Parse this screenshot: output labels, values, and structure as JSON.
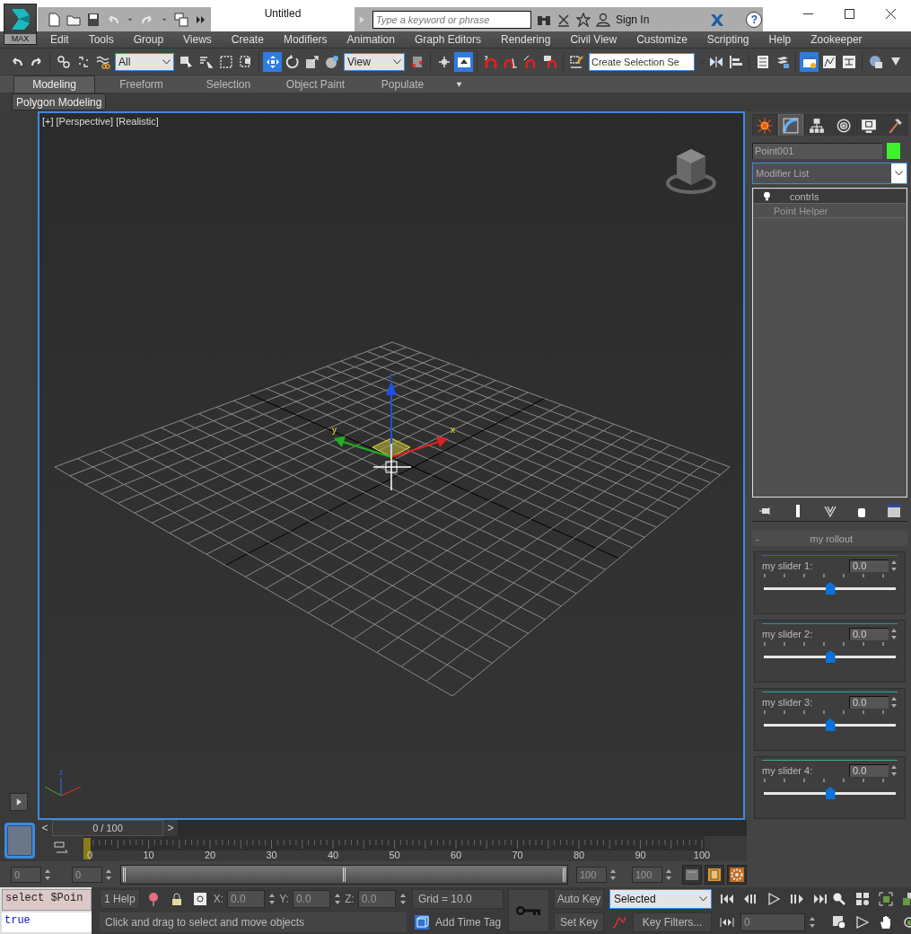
{
  "title_bar": {
    "app_label": "MAX",
    "title": "Untitled",
    "search_placeholder": "Type a keyword or phrase",
    "sign_in": "Sign In",
    "help": "?"
  },
  "menu": [
    "Edit",
    "Tools",
    "Group",
    "Views",
    "Create",
    "Modifiers",
    "Animation",
    "Graph Editors",
    "Rendering",
    "Civil View",
    "Customize",
    "Scripting",
    "Help",
    "Zookeeper"
  ],
  "main_toolbar": [
    {
      "kind": "undo",
      "selected": false
    },
    {
      "kind": "redo",
      "selected": false
    },
    {
      "kind": "sep"
    },
    {
      "kind": "link",
      "selected": false
    },
    {
      "kind": "unlink",
      "selected": false
    },
    {
      "kind": "wave",
      "selected": false
    },
    {
      "kind": "dropdown",
      "value": "All"
    },
    {
      "kind": "cursor",
      "selected": false
    },
    {
      "kind": "list-cursor",
      "selected": false
    },
    {
      "kind": "dashed-square",
      "selected": false
    },
    {
      "kind": "crossing",
      "selected": false
    },
    {
      "kind": "sep"
    },
    {
      "kind": "move",
      "selected": true
    },
    {
      "kind": "rotate",
      "selected": false
    },
    {
      "kind": "scale",
      "selected": false
    },
    {
      "kind": "sphere",
      "selected": false
    },
    {
      "kind": "dropdown",
      "value": "View"
    },
    {
      "kind": "pivot",
      "selected": false
    },
    {
      "kind": "sep"
    },
    {
      "kind": "crosshair",
      "selected": false
    },
    {
      "kind": "up-arrow-square",
      "selected": true
    },
    {
      "kind": "sep"
    },
    {
      "kind": "magnet",
      "selected": false
    },
    {
      "kind": "angle-magnet",
      "selected": false
    },
    {
      "kind": "percent-magnet",
      "selected": false
    },
    {
      "kind": "spinner-magnet",
      "selected": false
    },
    {
      "kind": "sep"
    },
    {
      "kind": "pencil",
      "selected": false
    },
    {
      "kind": "combo",
      "placeholder": "Create Selection Se"
    },
    {
      "kind": "mirror",
      "selected": false
    },
    {
      "kind": "align",
      "selected": false
    },
    {
      "kind": "sep"
    },
    {
      "kind": "list-window",
      "selected": false
    },
    {
      "kind": "layers",
      "selected": false
    },
    {
      "kind": "sep"
    },
    {
      "kind": "window-bulb",
      "selected": true
    },
    {
      "kind": "graph-window",
      "selected": false
    },
    {
      "kind": "schematic",
      "selected": false
    },
    {
      "kind": "sep"
    },
    {
      "kind": "globe",
      "selected": false
    },
    {
      "kind": "more",
      "selected": false
    }
  ],
  "ribbon": {
    "tabs": [
      {
        "label": "Modeling",
        "selected": true
      },
      {
        "label": "Freeform",
        "selected": false
      },
      {
        "label": "Selection",
        "selected": false
      },
      {
        "label": "Object Paint",
        "selected": false
      },
      {
        "label": "Populate",
        "selected": false
      }
    ],
    "panel": "Polygon Modeling"
  },
  "viewport": {
    "labels": [
      "[+]",
      "[Perspective]",
      "[Realistic]"
    ],
    "gizmo_axes": [
      "z",
      "y",
      "x"
    ],
    "tripod_axes": [
      "z"
    ]
  },
  "command_panel": {
    "tabs": [
      {
        "kind": "create",
        "selected": false
      },
      {
        "kind": "modify",
        "selected": true
      },
      {
        "kind": "hierarchy",
        "selected": false
      },
      {
        "kind": "motion",
        "selected": false
      },
      {
        "kind": "display",
        "selected": false
      },
      {
        "kind": "utilities",
        "selected": false
      }
    ],
    "object": {
      "name": "Point001",
      "color": "#3cf22c"
    },
    "modifier_list": "Modifier List",
    "stack": [
      {
        "label": "contrls",
        "selected": true
      },
      {
        "label": "Point Helper",
        "selected": false
      }
    ],
    "rollout": {
      "toggle": "-",
      "title": "my rollout",
      "sliders": [
        {
          "label": "my slider 1:",
          "value": "0.0",
          "level": 0.5,
          "color": "#4a55b0"
        },
        {
          "label": "my slider 2:",
          "value": "0.0",
          "level": 0.5,
          "color": "#3a8cb8"
        },
        {
          "label": "my slider 3:",
          "value": "0.0",
          "level": 0.5,
          "color": "#2aa894"
        },
        {
          "label": "my slider 4:",
          "value": "0.0",
          "level": 0.5,
          "color": "#3ab47c"
        }
      ]
    }
  },
  "timeline": {
    "prev": "<",
    "frame": "0 / 100",
    "next": ">",
    "ticks": [
      "0",
      "10",
      "20",
      "30",
      "40",
      "50",
      "60",
      "70",
      "80",
      "90",
      "100"
    ],
    "range_fields": [
      "0",
      "0",
      "100",
      "100"
    ]
  },
  "status_bar": {
    "listener_input": "select $Poin",
    "listener_output": "true",
    "help": "1 Help",
    "coords": [
      {
        "axis": "X:",
        "value": "0.0"
      },
      {
        "axis": "Y:",
        "value": "0.0"
      },
      {
        "axis": "Z:",
        "value": "0.0"
      }
    ],
    "grid": "Grid = 10.0",
    "prompt": "Click and drag to select and move objects",
    "time_tag": "Add Time Tag",
    "auto_key": "Auto Key",
    "key_mode": "Selected",
    "set_key": "Set Key",
    "key_filters": "Key Filters...",
    "frame": "0"
  }
}
